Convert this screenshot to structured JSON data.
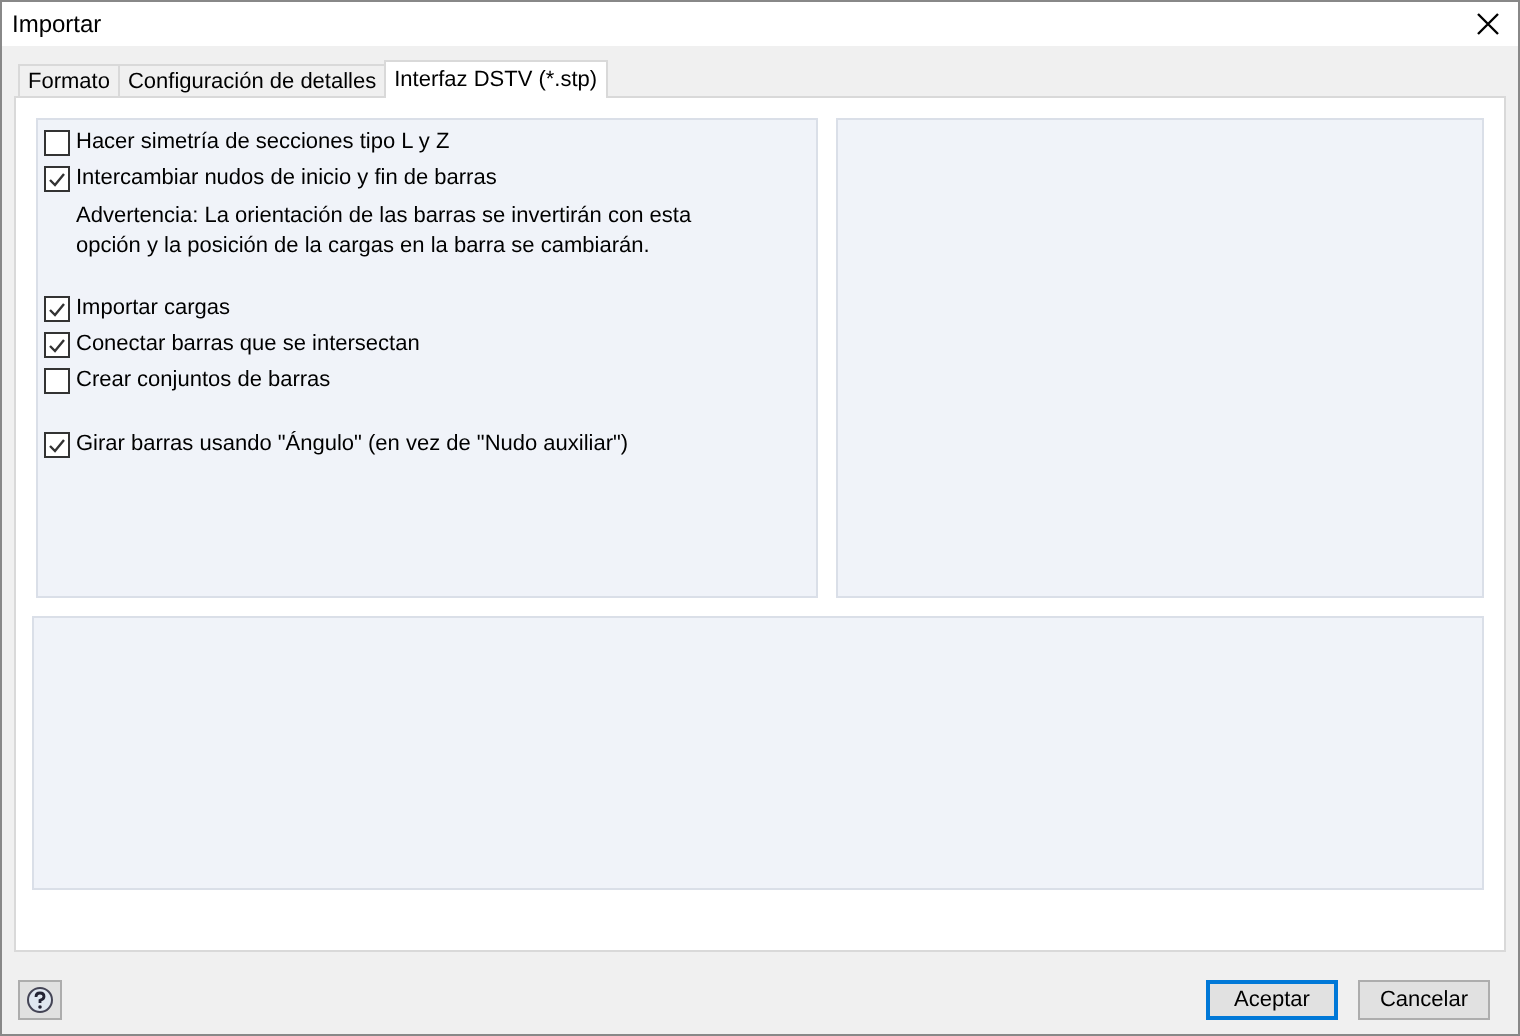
{
  "window": {
    "title": "Importar"
  },
  "tabs": [
    {
      "label": "Formato",
      "selected": false
    },
    {
      "label": "Configuración de detalles",
      "selected": false
    },
    {
      "label": "Interfaz DSTV (*.stp)",
      "selected": true
    }
  ],
  "options": [
    [
      {
        "kind": "checkbox",
        "label": "Hacer simetría de secciones tipo L y Z",
        "checked": false
      },
      {
        "kind": "checkbox",
        "label": "Intercambiar nudos de inicio y fin de barras",
        "checked": true
      },
      {
        "kind": "note",
        "label": "Advertencia: La orientación de las barras se invertirán con esta opción y la posición de la cargas en la barra se cambiarán."
      }
    ],
    [
      {
        "kind": "checkbox",
        "label": "Importar cargas",
        "checked": true
      },
      {
        "kind": "checkbox",
        "label": "Conectar barras que se intersectan",
        "checked": true
      },
      {
        "kind": "checkbox",
        "label": "Crear conjuntos de barras",
        "checked": false
      }
    ],
    [
      {
        "kind": "checkbox",
        "label": "Girar barras usando \"Ángulo\" (en vez de \"Nudo auxiliar\")",
        "checked": true
      }
    ]
  ],
  "buttons": [
    {
      "label": "Aceptar",
      "default": true
    },
    {
      "label": "Cancelar",
      "default": false
    }
  ]
}
